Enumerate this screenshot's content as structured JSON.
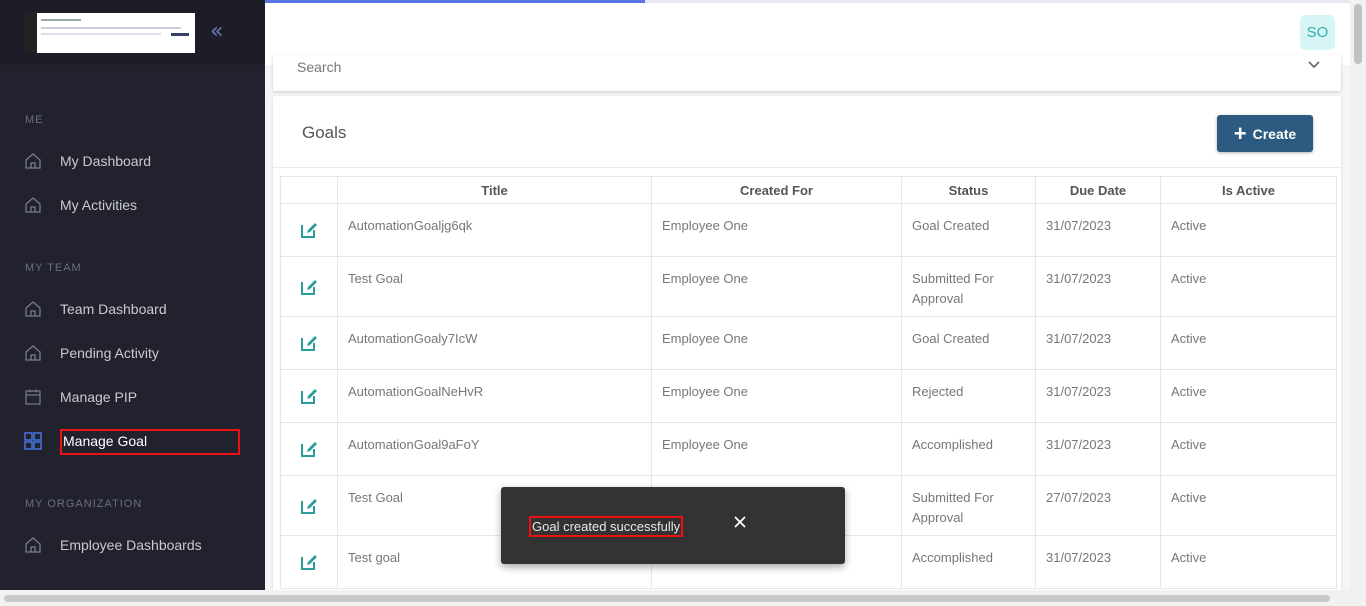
{
  "sidebar": {
    "sections": [
      {
        "label": "ME"
      },
      {
        "label": "MY TEAM"
      },
      {
        "label": "MY ORGANIZATION"
      }
    ],
    "items": [
      {
        "label": "My Dashboard",
        "icon": "home-icon"
      },
      {
        "label": "My Activities",
        "icon": "home-icon"
      },
      {
        "label": "Team Dashboard",
        "icon": "home-icon"
      },
      {
        "label": "Pending Activity",
        "icon": "home-icon"
      },
      {
        "label": "Manage PIP",
        "icon": "calendar-icon"
      },
      {
        "label": "Manage Goal",
        "icon": "grid-icon",
        "active": true
      },
      {
        "label": "Employee Dashboards",
        "icon": "home-icon"
      }
    ]
  },
  "topbar": {
    "avatar_initials": "SO",
    "progress_fraction": 0.35
  },
  "search": {
    "label": "Search"
  },
  "goals": {
    "title": "Goals",
    "create_label": "Create",
    "columns": [
      "Title",
      "Created For",
      "Status",
      "Due Date",
      "Is Active"
    ],
    "rows": [
      {
        "title": "AutomationGoalјg6qk",
        "created_for": "Employee One",
        "status": "Goal Created",
        "due_date": "31/07/2023",
        "is_active": "Active"
      },
      {
        "title": "Test Goal",
        "created_for": "Employee One",
        "status": "Submitted For Approval",
        "due_date": "31/07/2023",
        "is_active": "Active"
      },
      {
        "title": "AutomationGoaly7IcW",
        "created_for": "Employee One",
        "status": "Goal Created",
        "due_date": "31/07/2023",
        "is_active": "Active"
      },
      {
        "title": "AutomationGoalNeHvR",
        "created_for": "Employee One",
        "status": "Rejected",
        "due_date": "31/07/2023",
        "is_active": "Active"
      },
      {
        "title": "AutomationGoal9aFoY",
        "created_for": "Employee One",
        "status": "Accomplished",
        "due_date": "31/07/2023",
        "is_active": "Active"
      },
      {
        "title": "Test Goal",
        "created_for": "",
        "status": "Submitted For Approval",
        "due_date": "27/07/2023",
        "is_active": "Active"
      },
      {
        "title": "Test goal",
        "created_for": "",
        "status": "Accomplished",
        "due_date": "31/07/2023",
        "is_active": "Active"
      }
    ]
  },
  "toast": {
    "message": "Goal created successfully",
    "close_icon": "close-icon"
  },
  "colors": {
    "sidebar_bg": "#21222d",
    "primary_button": "#2d5a80",
    "accent": "#5a75e6",
    "edit_icon": "#2a9d9b",
    "highlight": "#e11111"
  }
}
